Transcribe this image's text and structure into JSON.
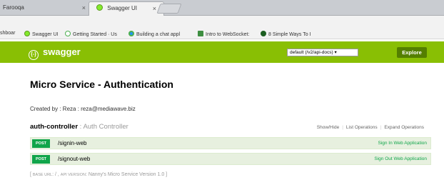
{
  "browser": {
    "tabs": [
      {
        "label": "Farooqa",
        "active": false
      },
      {
        "label": "Swagger UI",
        "active": true
      }
    ],
    "close_glyph": "×",
    "bookmarks": [
      {
        "label": "shboar",
        "icon": "page-icon",
        "color": "#bbbbbb"
      },
      {
        "label": "Swagger UI",
        "icon": "swagger-icon",
        "color": "#85ea2d"
      },
      {
        "label": "Getting Started · Us",
        "icon": "refresh-icon",
        "color": "#4caf50"
      },
      {
        "label": "Building a chat appl",
        "icon": "chrome-icon",
        "color": "#2196f3"
      },
      {
        "label": "Intro to WebSocket:",
        "icon": "doc-icon",
        "color": "#3e8e41"
      },
      {
        "label": "8 Simple Ways To I",
        "icon": "globe-icon",
        "color": "#1b5e20"
      }
    ]
  },
  "swagger": {
    "logo_text": "swagger",
    "logo_glyph": "{-}",
    "spec_select": "default (/v2/api-docs) ▾",
    "explore_label": "Explore",
    "accent": "#89bf04"
  },
  "info": {
    "title": "Micro Service - Authentication",
    "created_by": "Created by : Reza : reza@mediawave.biz"
  },
  "controller": {
    "name": "auth-controller",
    "separator": " : ",
    "description": "Auth Controller",
    "links": [
      "Show/Hide",
      "List Operations",
      "Expand Operations"
    ]
  },
  "operations": [
    {
      "method": "POST",
      "path": "/signin-web",
      "summary": "Sign In Web Application"
    },
    {
      "method": "POST",
      "path": "/signout-web",
      "summary": "Sign Out Web Application"
    }
  ],
  "footer": {
    "open": "[ ",
    "base_url_label": "BASE URL",
    "base_url_value": ": / , ",
    "api_version_label": "API VERSION",
    "api_version_value": ": Nanny's Micro Service Version 1.0 ]"
  }
}
